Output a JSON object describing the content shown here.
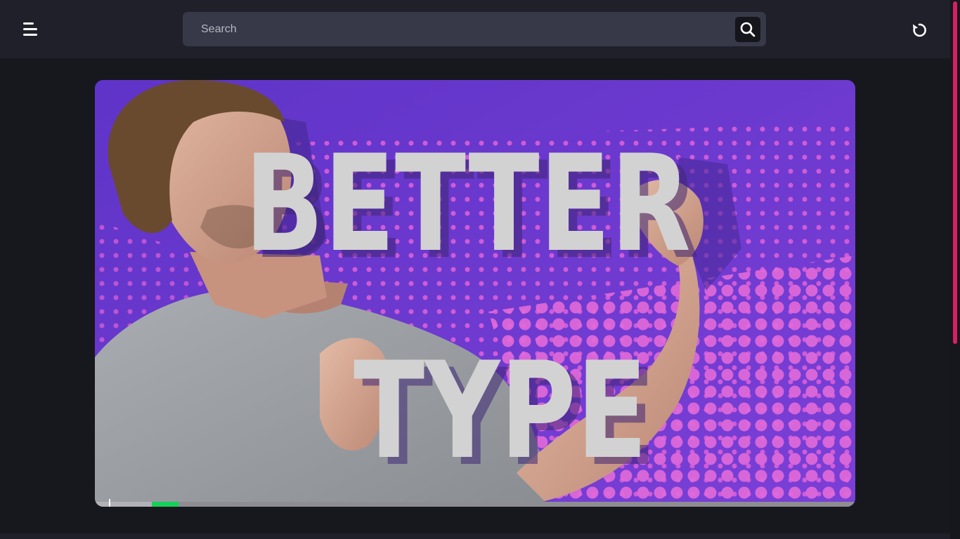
{
  "header": {
    "menu_icon": "hamburger-menu-icon",
    "search": {
      "placeholder": "Search",
      "value": ""
    },
    "search_icon": "search-icon",
    "reload_icon": "reload-icon"
  },
  "video": {
    "thumbnail_text": {
      "line1": "BETTER",
      "line2": "TYPE"
    },
    "progress": {
      "played_start": 0.075,
      "played_end": 0.11
    }
  },
  "colors": {
    "header_bg": "#1f2029",
    "page_bg": "#17181d",
    "search_bg": "#373848",
    "scroll_thumb": "#d81f64",
    "thumbnail_bg": "#6a35c9",
    "dots": "#e062d8",
    "progress_played": "#14d05a"
  }
}
